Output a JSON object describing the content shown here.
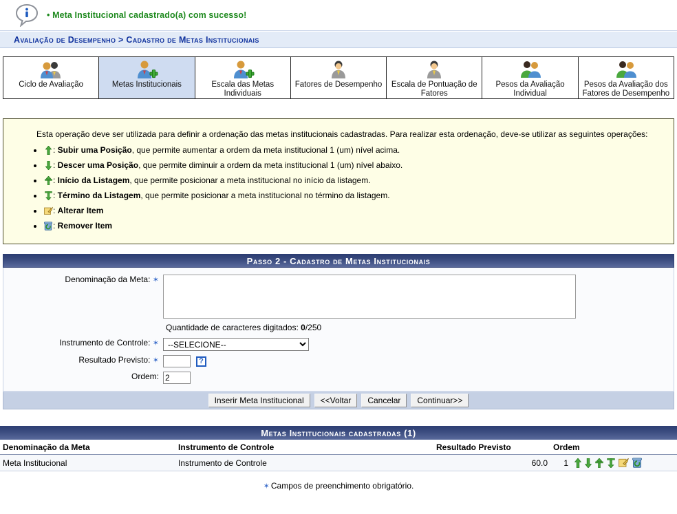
{
  "message": {
    "icon": "info-bubble-icon",
    "bullet": "•",
    "text": "Meta Institucional cadastrado(a) com sucesso!",
    "color": "#1f8a1f"
  },
  "breadcrumb": {
    "text": "Avaliação de Desempenho > Cadastro de Metas Institucionais"
  },
  "tabs": [
    {
      "label": "Ciclo de Avaliação",
      "icon": "two-users-icon",
      "active": false
    },
    {
      "label": "Metas Institucionais",
      "icon": "user-add-icon",
      "active": true
    },
    {
      "label": "Escala das Metas Individuais",
      "icon": "user-add-icon",
      "active": false
    },
    {
      "label": "Fatores de Desempenho",
      "icon": "user-gray-icon",
      "active": false
    },
    {
      "label": "Escala de Pontuação de Fatores",
      "icon": "user-gray-icon",
      "active": false
    },
    {
      "label": "Pesos da Avaliação Individual",
      "icon": "two-users-green-icon",
      "active": false
    },
    {
      "label": "Pesos da Avaliação dos Fatores de Desempenho",
      "icon": "two-users-green-icon",
      "active": false
    }
  ],
  "help": {
    "intro": "Esta operação deve ser utilizada para definir a ordenação das metas institucionais cadastradas. Para realizar esta ordenação, deve-se utilizar as seguintes operações:",
    "items": [
      {
        "icon": "arrow-up-icon",
        "term": "Subir uma Posição",
        "sep": ": ",
        "desc": ", que permite aumentar a ordem da meta institucional 1 (um) nível acima."
      },
      {
        "icon": "arrow-down-icon",
        "term": "Descer uma Posição",
        "sep": ": ",
        "desc": ", que permite diminuir a ordem da meta institucional 1 (um) nível abaixo."
      },
      {
        "icon": "move-to-top-icon",
        "term": "Início da Listagem",
        "sep": ": ",
        "desc": ", que permite posicionar a meta institucional no início da listagem."
      },
      {
        "icon": "move-to-bottom-icon",
        "term": "Término da Listagem",
        "sep": ": ",
        "desc": ", que permite posicionar a meta institucional no término da listagem."
      },
      {
        "icon": "edit-icon",
        "term": "Alterar Item",
        "sep": ": ",
        "desc": ""
      },
      {
        "icon": "delete-icon",
        "term": "Remover Item",
        "sep": ": ",
        "desc": ""
      }
    ]
  },
  "form": {
    "section_title": "Passo 2 - Cadastro de Metas Institucionais",
    "denominacao_label": "Denominação da Meta:",
    "denominacao_value": "",
    "denominacao_placeholder": "",
    "charcount_prefix": "Quantidade de caracteres digitados: ",
    "charcount_current": "0",
    "charcount_suffix": "/250",
    "instrumento_label": "Instrumento de Controle:",
    "instrumento_selected": "--SELECIONE--",
    "instrumento_options": [
      "--SELECIONE--"
    ],
    "resultado_label": "Resultado Previsto:",
    "resultado_value": "",
    "help_q_label": "?",
    "ordem_label": "Ordem:",
    "ordem_value": "2",
    "required_marker": "✶"
  },
  "buttons": {
    "inserir": "Inserir Meta Institucional",
    "voltar": "<<Voltar",
    "cancelar": "Cancelar",
    "continuar": "Continuar>>"
  },
  "table": {
    "title": "Metas Institucionais cadastradas (1)",
    "columns": [
      "Denominação da Meta",
      "Instrumento de Controle",
      "Resultado Previsto",
      "Ordem"
    ],
    "rows": [
      {
        "denominacao": "Meta Institucional",
        "instrumento": "Instrumento de Controle",
        "resultado": "60.0",
        "ordem": "1",
        "actions": [
          "arrow-up-icon",
          "arrow-down-icon",
          "move-to-top-icon",
          "move-to-bottom-icon",
          "edit-icon",
          "delete-icon"
        ]
      }
    ]
  },
  "footnote": {
    "marker": "✶",
    "text": "Campos de preenchimento obrigatório."
  },
  "colors": {
    "success_green": "#1f8a1f",
    "breadcrumb_blue": "#11339e",
    "section_bar_dark": "#2c3d72",
    "section_bar_light": "#59699b",
    "active_tab_bg": "#cfdcf1",
    "help_bg": "#fefee6",
    "button_row_bg": "#c5d0e4"
  }
}
